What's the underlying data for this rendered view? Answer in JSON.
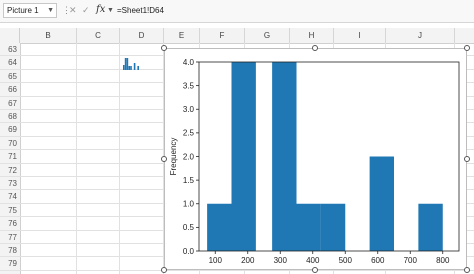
{
  "formula_bar": {
    "name_box": "Picture 1",
    "separator": "⋮",
    "cancel_glyph": "✕",
    "enter_glyph": "✓",
    "fx": "fx",
    "formula": "=Sheet1!D64"
  },
  "columns": [
    "B",
    "C",
    "D",
    "E",
    "F",
    "G",
    "H",
    "I",
    "J"
  ],
  "rows": [
    "63",
    "64",
    "65",
    "66",
    "67",
    "68",
    "69",
    "70",
    "71",
    "72",
    "73",
    "74",
    "75",
    "76",
    "77",
    "78",
    "79"
  ],
  "chart_data": {
    "type": "bar",
    "ylabel": "Frequency",
    "xlabel": "",
    "xlim": [
      50,
      850
    ],
    "ylim": [
      0,
      4.0
    ],
    "xticks": [
      100,
      200,
      300,
      400,
      500,
      600,
      700,
      800
    ],
    "yticks": [
      0.0,
      0.5,
      1.0,
      1.5,
      2.0,
      2.5,
      3.0,
      3.5,
      4.0
    ],
    "bins": [
      {
        "start": 75,
        "end": 150,
        "count": 1
      },
      {
        "start": 150,
        "end": 225,
        "count": 4
      },
      {
        "start": 225,
        "end": 275,
        "count": 0
      },
      {
        "start": 275,
        "end": 350,
        "count": 4
      },
      {
        "start": 350,
        "end": 425,
        "count": 1
      },
      {
        "start": 425,
        "end": 500,
        "count": 1
      },
      {
        "start": 500,
        "end": 575,
        "count": 0
      },
      {
        "start": 575,
        "end": 650,
        "count": 2
      },
      {
        "start": 650,
        "end": 725,
        "count": 0
      },
      {
        "start": 725,
        "end": 800,
        "count": 1
      }
    ],
    "bar_color": "#1f77b4"
  }
}
